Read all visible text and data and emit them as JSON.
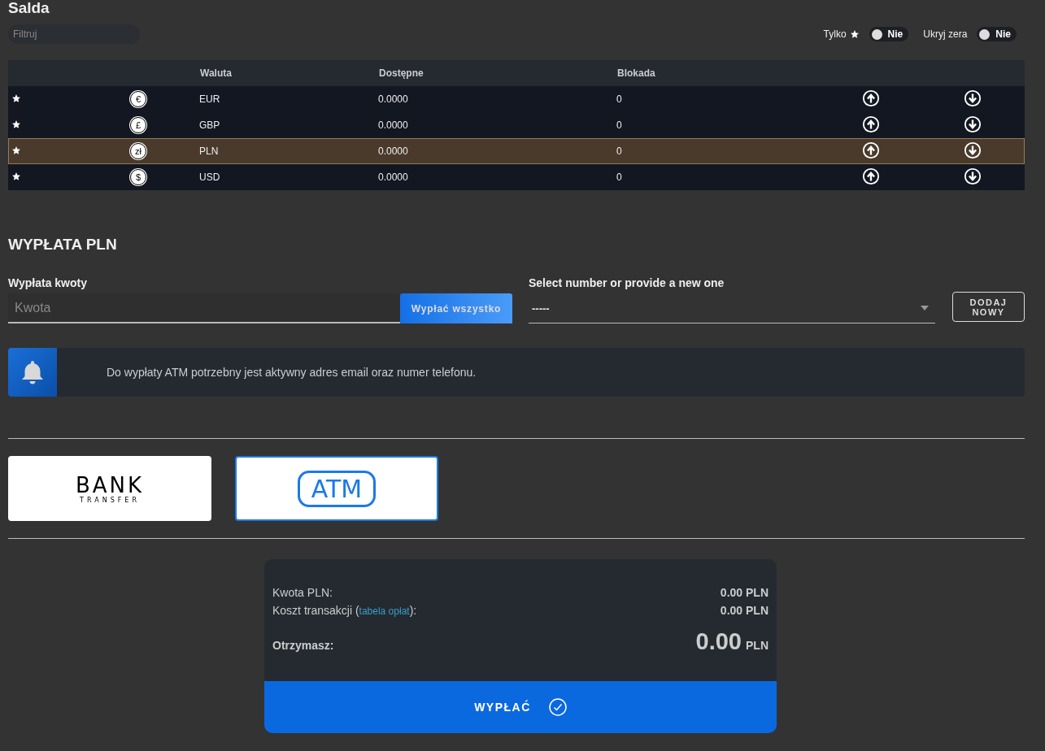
{
  "title": "Salda",
  "filter": {
    "placeholder": "Filtruj"
  },
  "toggles": [
    {
      "label": "Tylko",
      "star": true,
      "value": "Nie",
      "on": false
    },
    {
      "label": "Ukryj zera",
      "star": false,
      "value": "Nie",
      "on": false
    }
  ],
  "table": {
    "columns": [
      "Waluta",
      "Dostępne",
      "Blokada"
    ],
    "rows": [
      {
        "symbol": "€",
        "currency": "EUR",
        "available": "0.0000",
        "blocked": "0",
        "selected": false
      },
      {
        "symbol": "£",
        "currency": "GBP",
        "available": "0.0000",
        "blocked": "0",
        "selected": false
      },
      {
        "symbol": "zł",
        "currency": "PLN",
        "available": "0.0000",
        "blocked": "0",
        "selected": true
      },
      {
        "symbol": "$",
        "currency": "USD",
        "available": "0.0000",
        "blocked": "0",
        "selected": false
      }
    ]
  },
  "withdrawal": {
    "heading": "WYPŁATA PLN",
    "amount": {
      "label": "Wypłata kwoty",
      "placeholder": "Kwota",
      "button": "Wypłać wszystko"
    },
    "number": {
      "label": "Select number or provide a new one",
      "value": "-----",
      "button": "DODAJ NOWY"
    },
    "alert": "Do wypłaty ATM potrzebny jest aktywny adres email oraz numer telefonu.",
    "methods": [
      {
        "kind": "bank",
        "title": "BANK",
        "subtitle": "TRANSFER",
        "selected": false
      },
      {
        "kind": "atm",
        "title": "ATM",
        "selected": true
      }
    ],
    "summary": {
      "amount_label": "Kwota PLN:",
      "amount_value": "0.00 PLN",
      "fee_label_before": "Koszt transakcji (",
      "fee_link": "tabela opłat",
      "fee_label_after": "):",
      "fee_value": "0.00 PLN",
      "receive_label": "Otrzymasz:",
      "receive_value": "0.00",
      "receive_currency": "PLN"
    },
    "submit": "WYPŁAĆ"
  }
}
